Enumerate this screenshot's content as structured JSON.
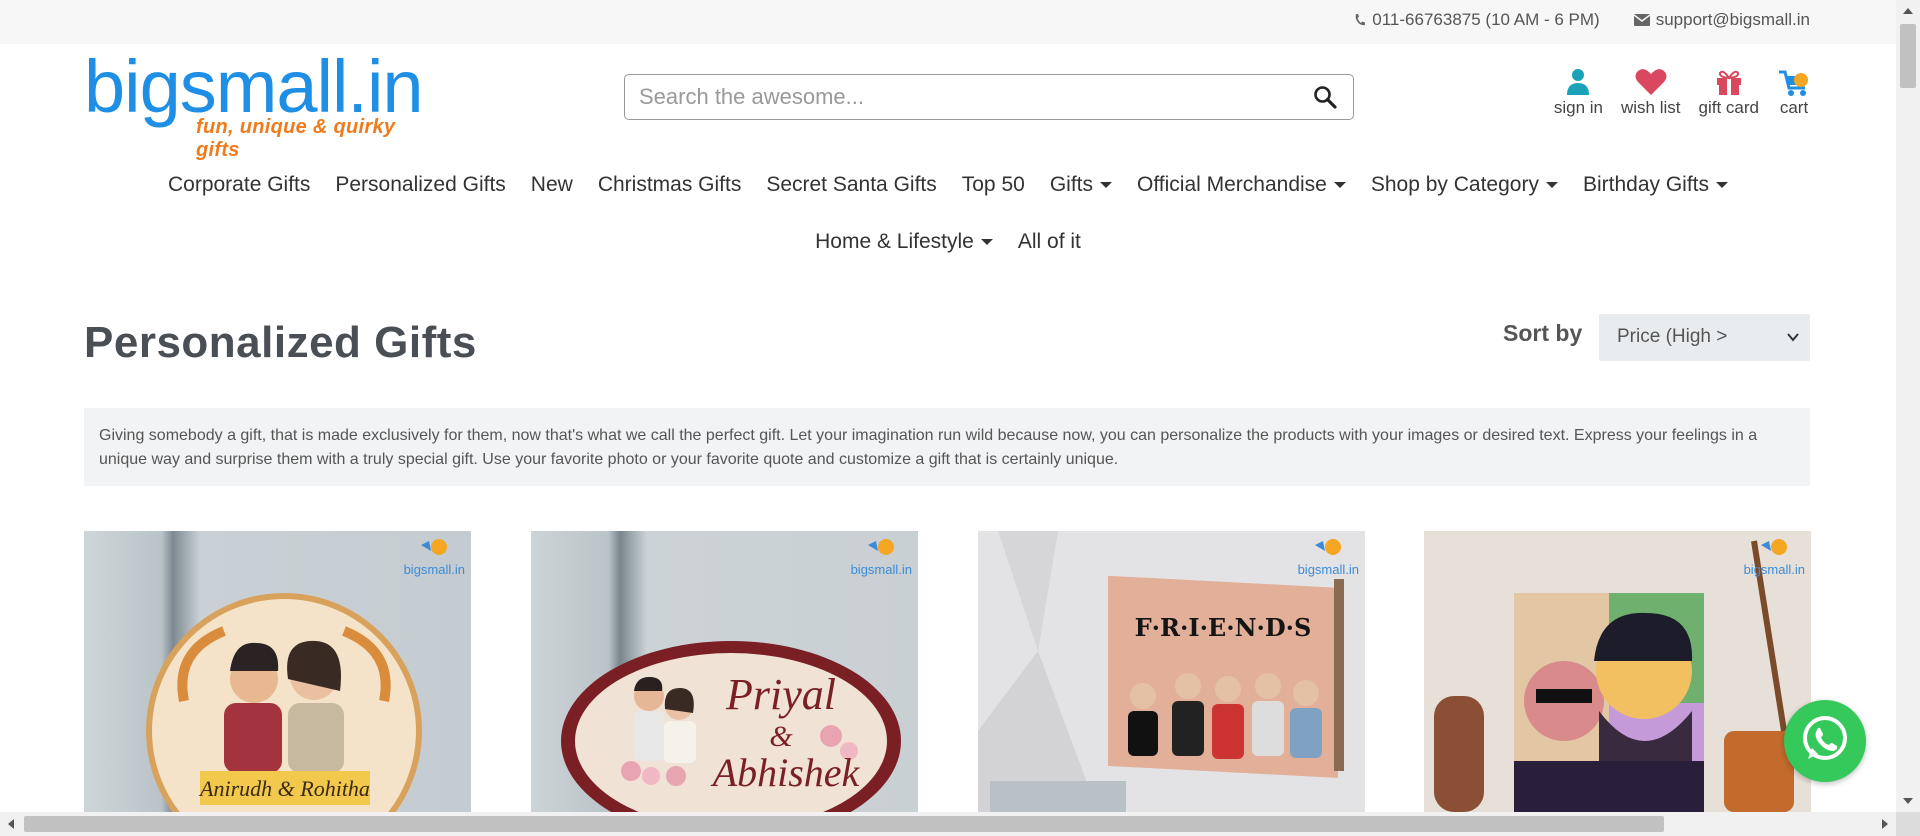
{
  "topbar": {
    "phone": "011-66763875 (10 AM - 6 PM)",
    "email": "support@bigsmall.in"
  },
  "logo": {
    "brand": "bigsmall.in",
    "tagline": "fun, unique & quirky gifts"
  },
  "search": {
    "placeholder": "Search the awesome..."
  },
  "user_icons": [
    {
      "label": "sign in",
      "icon": "user-icon"
    },
    {
      "label": "wish list",
      "icon": "heart-icon"
    },
    {
      "label": "gift card",
      "icon": "gift-icon"
    },
    {
      "label": "cart",
      "icon": "cart-icon"
    }
  ],
  "nav": {
    "row1": [
      {
        "label": "Corporate Gifts",
        "dropdown": false
      },
      {
        "label": "Personalized Gifts",
        "dropdown": false
      },
      {
        "label": "New",
        "dropdown": false
      },
      {
        "label": "Christmas Gifts",
        "dropdown": false
      },
      {
        "label": "Secret Santa Gifts",
        "dropdown": false
      },
      {
        "label": "Top 50",
        "dropdown": false
      },
      {
        "label": "Gifts",
        "dropdown": true
      },
      {
        "label": "Official Merchandise",
        "dropdown": true
      },
      {
        "label": "Shop by Category",
        "dropdown": true
      },
      {
        "label": "Birthday Gifts",
        "dropdown": true
      }
    ],
    "row2": [
      {
        "label": "Home & Lifestyle",
        "dropdown": true
      },
      {
        "label": "All of it",
        "dropdown": false
      }
    ]
  },
  "page": {
    "title": "Personalized Gifts",
    "sort_label": "Sort by",
    "sort_value": "Price (High >",
    "description": "Giving somebody a gift, that is made exclusively for them, now that's what we call the perfect gift. Let your imagination run wild because now, you can personalize the products with your images or desired text. Express your feelings in a unique way and surprise them with a truly special gift. Use your favorite photo or your favorite quote and customize a gift that is certainly unique."
  },
  "products": [
    {
      "image_text": "Anirudh & Rohitha",
      "watermark": "bigsmall.in"
    },
    {
      "image_text_1": "Priyal",
      "image_text_2": "&",
      "image_text_3": "Abhishek",
      "watermark": "bigsmall.in"
    },
    {
      "image_text": "F·R·I·E·N·D·S",
      "watermark": "bigsmall.in"
    },
    {
      "watermark": "bigsmall.in"
    }
  ],
  "colors": {
    "brand_blue": "#1f8fe5",
    "brand_orange": "#f07b1d",
    "whatsapp_green": "#35c85a",
    "user_icon": "#1aa3b8",
    "heart": "#d9485f"
  }
}
